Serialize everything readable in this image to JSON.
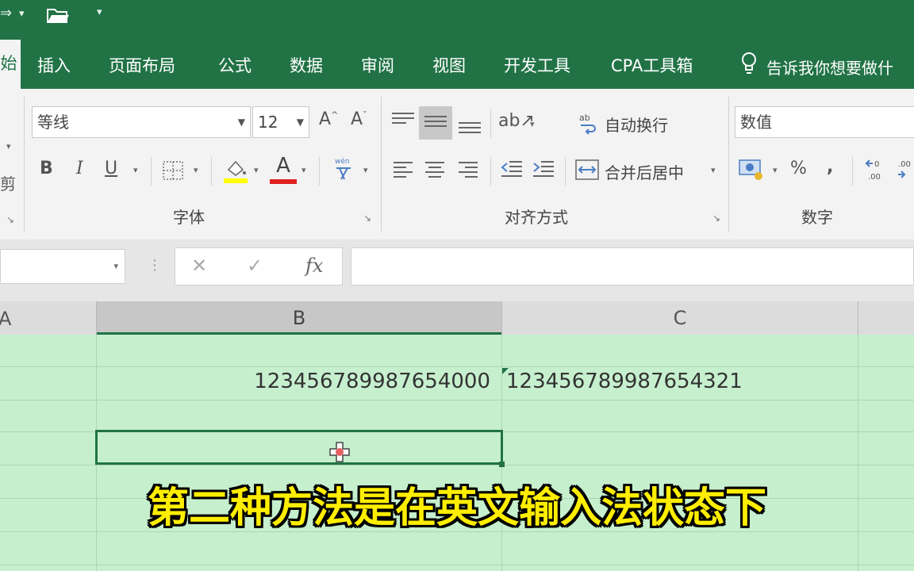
{
  "quick_access": {
    "redo_icon": "redo-icon",
    "open_icon": "folder-open-icon",
    "customize_icon": "customize-toolbar-icon"
  },
  "tabs": {
    "home_partial": "始",
    "items": [
      "插入",
      "页面布局",
      "公式",
      "数据",
      "审阅",
      "视图",
      "开发工具",
      "CPA工具箱"
    ],
    "tell_me": "告诉我你想要做什"
  },
  "font_group": {
    "font_name": "等线",
    "font_size": "12",
    "bold": "B",
    "italic": "I",
    "underline": "U",
    "font_color_glyph": "A",
    "increase_font": "A",
    "decrease_font": "A",
    "label": "字体"
  },
  "clipboard_partial": {
    "cut_partial": "剪"
  },
  "align_group": {
    "wrap_text": "自动换行",
    "merge_center": "合并后居中",
    "label": "对齐方式"
  },
  "number_group": {
    "format": "数值",
    "percent": "%",
    "comma": ",",
    "label": "数字"
  },
  "formula_bar": {
    "cancel": "✕",
    "enter": "✓",
    "fx": "fx",
    "value": ""
  },
  "columns": {
    "a": "A",
    "b": "B",
    "c": "C"
  },
  "cells": {
    "b_row1": "123456789987654000",
    "c_row1": "123456789987654321"
  },
  "subtitle": "第二种方法是在英文输入法状态下",
  "colors": {
    "excel_green": "#217346",
    "cell_fill": "#c6efce",
    "subtitle_yellow": "#ffee00"
  }
}
